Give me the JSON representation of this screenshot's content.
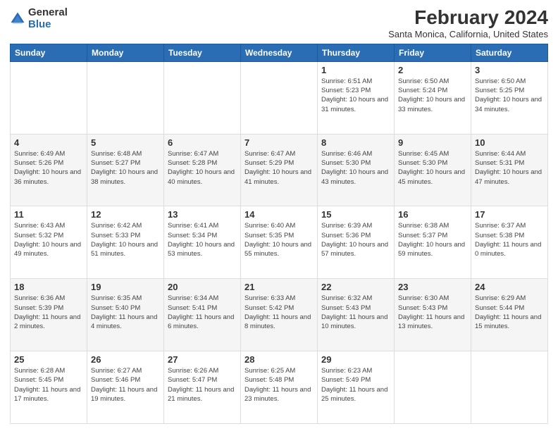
{
  "logo": {
    "general": "General",
    "blue": "Blue"
  },
  "title": "February 2024",
  "subtitle": "Santa Monica, California, United States",
  "days_of_week": [
    "Sunday",
    "Monday",
    "Tuesday",
    "Wednesday",
    "Thursday",
    "Friday",
    "Saturday"
  ],
  "weeks": [
    [
      {
        "day": "",
        "info": ""
      },
      {
        "day": "",
        "info": ""
      },
      {
        "day": "",
        "info": ""
      },
      {
        "day": "",
        "info": ""
      },
      {
        "day": "1",
        "info": "Sunrise: 6:51 AM\nSunset: 5:23 PM\nDaylight: 10 hours and 31 minutes."
      },
      {
        "day": "2",
        "info": "Sunrise: 6:50 AM\nSunset: 5:24 PM\nDaylight: 10 hours and 33 minutes."
      },
      {
        "day": "3",
        "info": "Sunrise: 6:50 AM\nSunset: 5:25 PM\nDaylight: 10 hours and 34 minutes."
      }
    ],
    [
      {
        "day": "4",
        "info": "Sunrise: 6:49 AM\nSunset: 5:26 PM\nDaylight: 10 hours and 36 minutes."
      },
      {
        "day": "5",
        "info": "Sunrise: 6:48 AM\nSunset: 5:27 PM\nDaylight: 10 hours and 38 minutes."
      },
      {
        "day": "6",
        "info": "Sunrise: 6:47 AM\nSunset: 5:28 PM\nDaylight: 10 hours and 40 minutes."
      },
      {
        "day": "7",
        "info": "Sunrise: 6:47 AM\nSunset: 5:29 PM\nDaylight: 10 hours and 41 minutes."
      },
      {
        "day": "8",
        "info": "Sunrise: 6:46 AM\nSunset: 5:30 PM\nDaylight: 10 hours and 43 minutes."
      },
      {
        "day": "9",
        "info": "Sunrise: 6:45 AM\nSunset: 5:30 PM\nDaylight: 10 hours and 45 minutes."
      },
      {
        "day": "10",
        "info": "Sunrise: 6:44 AM\nSunset: 5:31 PM\nDaylight: 10 hours and 47 minutes."
      }
    ],
    [
      {
        "day": "11",
        "info": "Sunrise: 6:43 AM\nSunset: 5:32 PM\nDaylight: 10 hours and 49 minutes."
      },
      {
        "day": "12",
        "info": "Sunrise: 6:42 AM\nSunset: 5:33 PM\nDaylight: 10 hours and 51 minutes."
      },
      {
        "day": "13",
        "info": "Sunrise: 6:41 AM\nSunset: 5:34 PM\nDaylight: 10 hours and 53 minutes."
      },
      {
        "day": "14",
        "info": "Sunrise: 6:40 AM\nSunset: 5:35 PM\nDaylight: 10 hours and 55 minutes."
      },
      {
        "day": "15",
        "info": "Sunrise: 6:39 AM\nSunset: 5:36 PM\nDaylight: 10 hours and 57 minutes."
      },
      {
        "day": "16",
        "info": "Sunrise: 6:38 AM\nSunset: 5:37 PM\nDaylight: 10 hours and 59 minutes."
      },
      {
        "day": "17",
        "info": "Sunrise: 6:37 AM\nSunset: 5:38 PM\nDaylight: 11 hours and 0 minutes."
      }
    ],
    [
      {
        "day": "18",
        "info": "Sunrise: 6:36 AM\nSunset: 5:39 PM\nDaylight: 11 hours and 2 minutes."
      },
      {
        "day": "19",
        "info": "Sunrise: 6:35 AM\nSunset: 5:40 PM\nDaylight: 11 hours and 4 minutes."
      },
      {
        "day": "20",
        "info": "Sunrise: 6:34 AM\nSunset: 5:41 PM\nDaylight: 11 hours and 6 minutes."
      },
      {
        "day": "21",
        "info": "Sunrise: 6:33 AM\nSunset: 5:42 PM\nDaylight: 11 hours and 8 minutes."
      },
      {
        "day": "22",
        "info": "Sunrise: 6:32 AM\nSunset: 5:43 PM\nDaylight: 11 hours and 10 minutes."
      },
      {
        "day": "23",
        "info": "Sunrise: 6:30 AM\nSunset: 5:43 PM\nDaylight: 11 hours and 13 minutes."
      },
      {
        "day": "24",
        "info": "Sunrise: 6:29 AM\nSunset: 5:44 PM\nDaylight: 11 hours and 15 minutes."
      }
    ],
    [
      {
        "day": "25",
        "info": "Sunrise: 6:28 AM\nSunset: 5:45 PM\nDaylight: 11 hours and 17 minutes."
      },
      {
        "day": "26",
        "info": "Sunrise: 6:27 AM\nSunset: 5:46 PM\nDaylight: 11 hours and 19 minutes."
      },
      {
        "day": "27",
        "info": "Sunrise: 6:26 AM\nSunset: 5:47 PM\nDaylight: 11 hours and 21 minutes."
      },
      {
        "day": "28",
        "info": "Sunrise: 6:25 AM\nSunset: 5:48 PM\nDaylight: 11 hours and 23 minutes."
      },
      {
        "day": "29",
        "info": "Sunrise: 6:23 AM\nSunset: 5:49 PM\nDaylight: 11 hours and 25 minutes."
      },
      {
        "day": "",
        "info": ""
      },
      {
        "day": "",
        "info": ""
      }
    ]
  ]
}
